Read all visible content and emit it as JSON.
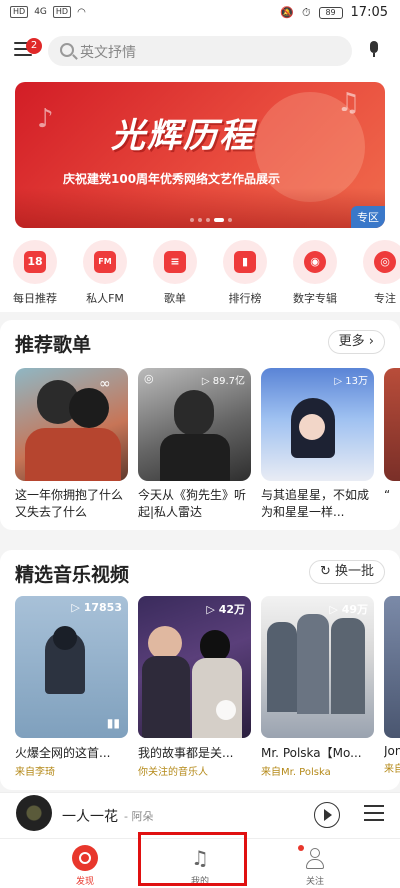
{
  "status_bar": {
    "time": "17:05",
    "battery": "89",
    "sim1": "HD",
    "sim2": "HD",
    "signal": "4G"
  },
  "top_bar": {
    "menu_badge": "2",
    "search_placeholder": "英文抒情"
  },
  "banner": {
    "title": "光辉历程",
    "subtitle": "庆祝建党100周年优秀网络文艺作品展示",
    "tag": "专区"
  },
  "quick_links": [
    {
      "label": "每日推荐",
      "icon": "calendar-icon",
      "glyph": "18"
    },
    {
      "label": "私人FM",
      "icon": "radio-icon",
      "glyph": "FM"
    },
    {
      "label": "歌单",
      "icon": "playlist-icon",
      "glyph": "≡"
    },
    {
      "label": "排行榜",
      "icon": "chart-icon",
      "glyph": "▮"
    },
    {
      "label": "数字专辑",
      "icon": "album-icon",
      "glyph": "◉"
    },
    {
      "label": "专注",
      "icon": "focus-icon",
      "glyph": "◎"
    }
  ],
  "recommended": {
    "title": "推荐歌单",
    "more": "更多",
    "items": [
      {
        "title": "这一年你拥抱了什么 又失去了什么",
        "plays": ""
      },
      {
        "title": "今天从《狗先生》听起|私人雷达",
        "plays": "89.7亿"
      },
      {
        "title": "与其追星星，不如成为和星星一样...",
        "plays": "13万"
      },
      {
        "title": "“",
        "plays": ""
      }
    ]
  },
  "videos": {
    "title": "精选音乐视频",
    "refresh": "换一批",
    "items": [
      {
        "title": "火爆全网的这首...",
        "source": "来自李琦",
        "plays": "17853"
      },
      {
        "title": "我的故事都是关...",
        "source": "你关注的音乐人",
        "plays": "42万"
      },
      {
        "title": "Mr. Polska【Mo...",
        "source": "来自Mr. Polska",
        "plays": "49万"
      },
      {
        "title": "Jon",
        "source": "来自",
        "plays": ""
      }
    ]
  },
  "player": {
    "song": "一人一花",
    "artist": "- 阿朵"
  },
  "tabs": [
    {
      "label": "发现",
      "active": true
    },
    {
      "label": "我的",
      "active": false
    },
    {
      "label": "关注",
      "active": false
    }
  ]
}
